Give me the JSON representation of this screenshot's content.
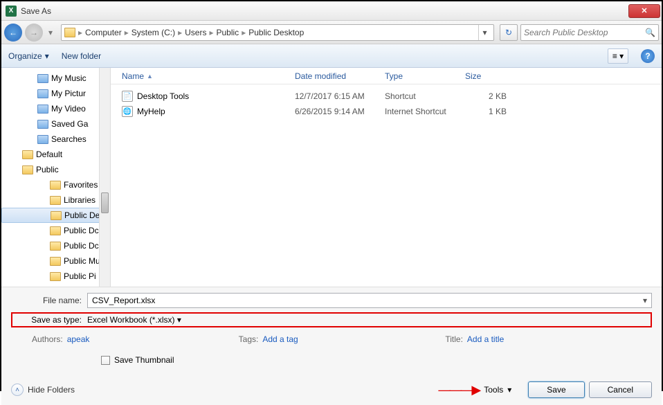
{
  "title": "Save As",
  "breadcrumb": [
    "Computer",
    "System (C:)",
    "Users",
    "Public",
    "Public Desktop"
  ],
  "search_placeholder": "Search Public Desktop",
  "toolbar": {
    "organize": "Organize",
    "newfolder": "New folder"
  },
  "tree": [
    {
      "label": "My Music",
      "cls": "indent1 blue"
    },
    {
      "label": "My Pictur",
      "cls": "indent1 blue"
    },
    {
      "label": "My Video",
      "cls": "indent1 blue"
    },
    {
      "label": "Saved Ga",
      "cls": "indent1 blue"
    },
    {
      "label": "Searches",
      "cls": "indent1 blue"
    },
    {
      "label": "Default",
      "cls": "indent2"
    },
    {
      "label": "Public",
      "cls": "indent2"
    },
    {
      "label": "Favorites",
      "cls": "indent3"
    },
    {
      "label": "Libraries",
      "cls": "indent3"
    },
    {
      "label": "Public De",
      "cls": "indent3 selected"
    },
    {
      "label": "Public Dc",
      "cls": "indent3"
    },
    {
      "label": "Public Dc",
      "cls": "indent3"
    },
    {
      "label": "Public Mu",
      "cls": "indent3"
    },
    {
      "label": "Public Pi",
      "cls": "indent3"
    }
  ],
  "columns": {
    "name": "Name",
    "date": "Date modified",
    "type": "Type",
    "size": "Size"
  },
  "files": [
    {
      "icon": "pdf",
      "name": "Desktop Tools",
      "date": "12/7/2017 6:15 AM",
      "type": "Shortcut",
      "size": "2 KB"
    },
    {
      "icon": "url",
      "name": "MyHelp",
      "date": "6/26/2015 9:14 AM",
      "type": "Internet Shortcut",
      "size": "1 KB"
    }
  ],
  "form": {
    "filename_label": "File name:",
    "filename_value": "CSV_Report.xlsx",
    "savetype_label": "Save as type:",
    "savetype_value": "Excel Workbook (*.xlsx)"
  },
  "meta": {
    "authors_label": "Authors:",
    "authors_value": "apeak",
    "tags_label": "Tags:",
    "tags_value": "Add a tag",
    "title_label": "Title:",
    "title_value": "Add a title"
  },
  "thumbnail_label": "Save Thumbnail",
  "footer": {
    "hide": "Hide Folders",
    "tools": "Tools",
    "save": "Save",
    "cancel": "Cancel"
  }
}
